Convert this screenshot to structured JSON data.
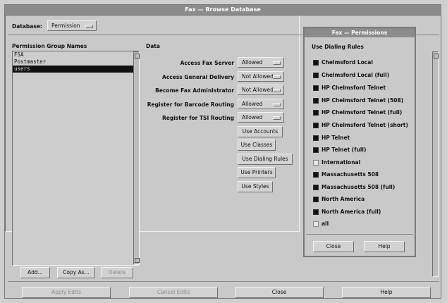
{
  "window": {
    "title": "Fax — Browse Database"
  },
  "database": {
    "label": "Database:",
    "value": "Permission"
  },
  "groups": {
    "header": "Permission Group Names",
    "items": [
      "FSA",
      "Postmaster",
      "users"
    ],
    "selected_index": 2
  },
  "data_header": "Data",
  "settings": [
    {
      "label": "Access Fax Server",
      "value": "Allowed"
    },
    {
      "label": "Access General Delivery",
      "value": "Not Allowed"
    },
    {
      "label": "Become Fax Administrator",
      "value": "Not Allowed"
    },
    {
      "label": "Register for Barcode Routing",
      "value": "Allowed"
    },
    {
      "label": "Register for TSI Routing",
      "value": "Allowed"
    }
  ],
  "use_buttons": [
    "Use Accounts",
    "Use Classes",
    "Use Dialing Rules",
    "Use Printers",
    "Use Styles"
  ],
  "group_buttons": {
    "add": "Add...",
    "copy": "Copy As...",
    "delete": "Delete"
  },
  "bottom_buttons": {
    "apply": "Apply Edits",
    "cancel": "Cancel Edits",
    "close": "Close",
    "help": "Help"
  },
  "permissions_dialog": {
    "title": "Fax — Permissions",
    "header": "Use Dialing Rules",
    "rules": [
      {
        "label": "Chelmsford Local",
        "checked": true
      },
      {
        "label": "Chelmsford Local (full)",
        "checked": true
      },
      {
        "label": "HP Chelmsford Telnet",
        "checked": true
      },
      {
        "label": "HP Chelmsford Telnet (508)",
        "checked": true
      },
      {
        "label": "HP Chelmsford Telnet (full)",
        "checked": true
      },
      {
        "label": "HP Chelmsford Telnet (short)",
        "checked": true
      },
      {
        "label": "HP Telnet",
        "checked": true
      },
      {
        "label": "HP Telnet (full)",
        "checked": true
      },
      {
        "label": "International",
        "checked": false
      },
      {
        "label": "Massachusetts 508",
        "checked": true
      },
      {
        "label": "Massachusetts 508 (full)",
        "checked": true
      },
      {
        "label": "North America",
        "checked": true
      },
      {
        "label": "North America (full)",
        "checked": true
      },
      {
        "label": "all",
        "checked": false
      }
    ],
    "close": "Close",
    "help": "Help"
  }
}
